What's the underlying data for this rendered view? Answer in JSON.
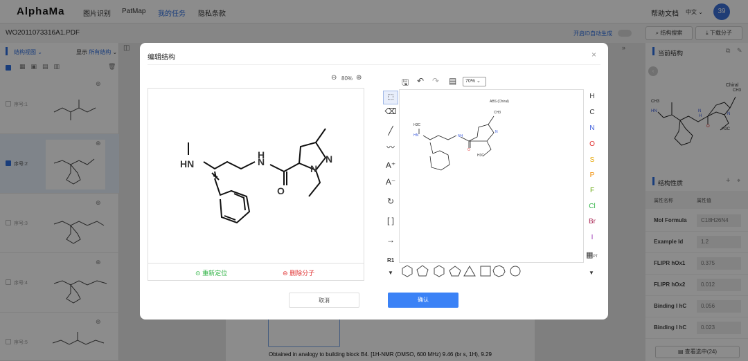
{
  "app": {
    "logo": "AlphaMa",
    "user_initials": "39"
  },
  "nav": {
    "items": [
      "图片识别",
      "PatMap",
      "我的任务",
      "隐私条款"
    ],
    "active": 2,
    "help": "帮助文档",
    "lang": "中文"
  },
  "file": {
    "name": "WO2011073316A1.PDF",
    "auto_id_label": "开启ID自动生成",
    "search_label": "结构搜索",
    "download_label": "下载分子"
  },
  "left": {
    "view_label": "结构视图",
    "show_label": "显示",
    "show_value": "所有结构",
    "items": [
      {
        "label": "序号:1",
        "checked": false
      },
      {
        "label": "序号:2",
        "checked": true
      },
      {
        "label": "序号:3",
        "checked": false
      },
      {
        "label": "序号:4",
        "checked": false
      },
      {
        "label": "序号:5",
        "checked": false
      }
    ]
  },
  "modal": {
    "title": "编辑结构",
    "zoom": "80%",
    "relocate_label": "重新定位",
    "delete_label": "删除分子",
    "cancel_label": "取消",
    "confirm_label": "确认",
    "editor_zoom": "70%",
    "abs_label": "ABS (Chiral)",
    "r1_label": "R1",
    "pt_label": "PT",
    "elements": [
      {
        "sym": "H",
        "color": "#333333"
      },
      {
        "sym": "C",
        "color": "#333333"
      },
      {
        "sym": "N",
        "color": "#3b5bdb"
      },
      {
        "sym": "O",
        "color": "#e03131"
      },
      {
        "sym": "S",
        "color": "#e6a400"
      },
      {
        "sym": "P",
        "color": "#f08c00"
      },
      {
        "sym": "F",
        "color": "#66a80f"
      },
      {
        "sym": "Cl",
        "color": "#2fb344"
      },
      {
        "sym": "Br",
        "color": "#a61e4d"
      },
      {
        "sym": "I",
        "color": "#9c36b5"
      }
    ]
  },
  "molecule": {
    "hn": "HN",
    "nh": "N",
    "h": "H",
    "o": "O",
    "n1": "N",
    "n2": "N",
    "small_ch3": "CH3",
    "small_h3c": "H3C",
    "small_hn": "HN",
    "small_nh": "NH",
    "small_n": "N",
    "small_o": "O",
    "small_h3c2": "H3C"
  },
  "right": {
    "current_label": "当前结构",
    "chiral_label": "Chiral",
    "ch3": "CH3",
    "hn": "HN",
    "nh": "N",
    "h": "H",
    "o": "O",
    "n": "N",
    "h3c": "H3C",
    "props_title": "结构性质",
    "col_name": "属性名称",
    "col_value": "属性值",
    "props": [
      {
        "name": "Mol Formula",
        "value": "C18H26N4"
      },
      {
        "name": "Example Id",
        "value": "1.2"
      },
      {
        "name": "FLIPR hOx1",
        "value": "0.375"
      },
      {
        "name": "FLIPR hOx2",
        "value": "0.012"
      },
      {
        "name": "Binding I hC",
        "value": "0.056"
      },
      {
        "name": "Binding I hC",
        "value": "0.023"
      }
    ],
    "view_selected": "查看选中(24)"
  },
  "doc": {
    "text": "Obtained in analogy to building block B4. [1H-NMR (DMSO, 600 MHz) 9.46 (br s, 1H), 9.29"
  }
}
